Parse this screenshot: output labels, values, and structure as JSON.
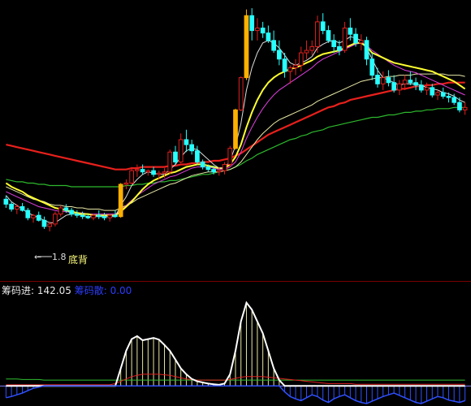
{
  "annotation": {
    "price_low": "1.8",
    "label": "底背"
  },
  "indicator": {
    "name1": "筹码进:",
    "value1": "142.05",
    "name2": "筹码散:",
    "value2": "0.00"
  },
  "colors": {
    "up": "#e0201e",
    "down": "#28ffff",
    "ma_red": "#e8201c",
    "ma_green": "#2db82d",
    "ma_yellow": "#ffff30",
    "ma_magenta": "#e040e0",
    "ma_white": "#dcdcdc",
    "ma_lightyellow": "#e8e8a8",
    "limit_up": "#ffb000"
  },
  "chart_data": {
    "type": "candlestick",
    "y_range_main": [
      1.4,
      3.6
    ],
    "x": [
      0,
      1,
      2,
      3,
      4,
      5,
      6,
      7,
      8,
      9,
      10,
      11,
      12,
      13,
      14,
      15,
      16,
      17,
      18,
      19,
      20,
      21,
      22,
      23,
      24,
      25,
      26,
      27,
      28,
      29,
      30,
      31,
      32,
      33,
      34,
      35,
      36,
      37,
      38,
      39,
      40,
      41,
      42,
      43,
      44,
      45,
      46,
      47,
      48,
      49,
      50,
      51,
      52,
      53,
      54,
      55,
      56,
      57,
      58,
      59,
      60,
      61,
      62,
      63,
      64,
      65,
      66,
      67,
      68,
      69,
      70,
      71,
      72,
      73,
      74,
      75,
      76,
      77,
      78,
      79,
      80,
      81,
      82,
      83,
      84
    ],
    "candles": [
      [
        2.02,
        2.05,
        1.95,
        1.98
      ],
      [
        1.98,
        2.0,
        1.92,
        1.94
      ],
      [
        1.94,
        1.98,
        1.9,
        1.96
      ],
      [
        1.96,
        1.99,
        1.92,
        1.93
      ],
      [
        1.93,
        1.95,
        1.85,
        1.87
      ],
      [
        1.87,
        1.9,
        1.83,
        1.89
      ],
      [
        1.89,
        1.92,
        1.84,
        1.85
      ],
      [
        1.85,
        1.88,
        1.78,
        1.8
      ],
      [
        1.8,
        1.84,
        1.76,
        1.82
      ],
      [
        1.82,
        1.92,
        1.8,
        1.9
      ],
      [
        1.9,
        1.97,
        1.88,
        1.95
      ],
      [
        1.95,
        1.98,
        1.91,
        1.93
      ],
      [
        1.93,
        1.95,
        1.88,
        1.9
      ],
      [
        1.9,
        1.93,
        1.87,
        1.89
      ],
      [
        1.89,
        1.92,
        1.86,
        1.88
      ],
      [
        1.88,
        1.9,
        1.86,
        1.87
      ],
      [
        1.87,
        1.9,
        1.85,
        1.89
      ],
      [
        1.89,
        1.93,
        1.86,
        1.88
      ],
      [
        1.88,
        1.91,
        1.85,
        1.87
      ],
      [
        1.87,
        1.9,
        1.84,
        1.89
      ],
      [
        1.89,
        1.93,
        1.87,
        1.88
      ],
      [
        1.88,
        2.15,
        1.87,
        2.14
      ],
      [
        2.14,
        2.18,
        2.1,
        2.15
      ],
      [
        2.15,
        2.28,
        2.14,
        2.25
      ],
      [
        2.25,
        2.3,
        2.2,
        2.26
      ],
      [
        2.26,
        2.3,
        2.22,
        2.24
      ],
      [
        2.24,
        2.26,
        2.21,
        2.25
      ],
      [
        2.25,
        2.28,
        2.2,
        2.22
      ],
      [
        2.22,
        2.25,
        2.18,
        2.23
      ],
      [
        2.23,
        2.27,
        2.19,
        2.24
      ],
      [
        2.24,
        2.42,
        2.22,
        2.4
      ],
      [
        2.4,
        2.45,
        2.3,
        2.32
      ],
      [
        2.32,
        2.55,
        2.31,
        2.5
      ],
      [
        2.5,
        2.58,
        2.4,
        2.46
      ],
      [
        2.46,
        2.5,
        2.38,
        2.41
      ],
      [
        2.41,
        2.45,
        2.3,
        2.32
      ],
      [
        2.32,
        2.34,
        2.26,
        2.28
      ],
      [
        2.28,
        2.3,
        2.24,
        2.26
      ],
      [
        2.26,
        2.29,
        2.22,
        2.24
      ],
      [
        2.24,
        2.28,
        2.21,
        2.25
      ],
      [
        2.25,
        2.32,
        2.22,
        2.3
      ],
      [
        2.3,
        2.45,
        2.28,
        2.43
      ],
      [
        2.43,
        2.75,
        2.42,
        2.74
      ],
      [
        2.74,
        3.01,
        2.73,
        3.0
      ],
      [
        3.0,
        3.55,
        2.98,
        3.5
      ],
      [
        3.5,
        3.56,
        3.3,
        3.38
      ],
      [
        3.38,
        3.48,
        3.3,
        3.4
      ],
      [
        3.4,
        3.45,
        3.32,
        3.36
      ],
      [
        3.36,
        3.42,
        3.28,
        3.3
      ],
      [
        3.3,
        3.38,
        3.2,
        3.22
      ],
      [
        3.22,
        3.3,
        3.1,
        3.15
      ],
      [
        3.15,
        3.2,
        3.0,
        3.05
      ],
      [
        3.05,
        3.1,
        2.95,
        3.08
      ],
      [
        3.08,
        3.15,
        3.02,
        3.1
      ],
      [
        3.1,
        3.25,
        3.05,
        3.2
      ],
      [
        3.2,
        3.3,
        3.15,
        3.22
      ],
      [
        3.22,
        3.3,
        3.18,
        3.25
      ],
      [
        3.25,
        3.5,
        3.2,
        3.45
      ],
      [
        3.45,
        3.52,
        3.35,
        3.38
      ],
      [
        3.38,
        3.42,
        3.28,
        3.3
      ],
      [
        3.3,
        3.35,
        3.2,
        3.25
      ],
      [
        3.25,
        3.3,
        3.18,
        3.22
      ],
      [
        3.22,
        3.45,
        3.2,
        3.4
      ],
      [
        3.4,
        3.48,
        3.3,
        3.35
      ],
      [
        3.35,
        3.4,
        3.25,
        3.28
      ],
      [
        3.28,
        3.35,
        3.22,
        3.3
      ],
      [
        3.3,
        3.33,
        3.1,
        3.15
      ],
      [
        3.15,
        3.2,
        2.98,
        3.02
      ],
      [
        3.02,
        3.08,
        2.92,
        2.95
      ],
      [
        2.95,
        3.05,
        2.9,
        3.0
      ],
      [
        3.0,
        3.06,
        2.93,
        2.96
      ],
      [
        2.96,
        3.02,
        2.88,
        2.9
      ],
      [
        2.9,
        2.98,
        2.86,
        2.95
      ],
      [
        2.95,
        3.02,
        2.9,
        2.98
      ],
      [
        2.98,
        3.05,
        2.94,
        2.96
      ],
      [
        2.96,
        3.0,
        2.9,
        2.94
      ],
      [
        2.94,
        2.98,
        2.88,
        2.9
      ],
      [
        2.9,
        2.96,
        2.86,
        2.92
      ],
      [
        2.92,
        2.95,
        2.84,
        2.86
      ],
      [
        2.86,
        2.9,
        2.82,
        2.88
      ],
      [
        2.88,
        2.92,
        2.83,
        2.85
      ],
      [
        2.85,
        2.88,
        2.8,
        2.84
      ],
      [
        2.84,
        2.87,
        2.78,
        2.8
      ],
      [
        2.8,
        2.84,
        2.72,
        2.74
      ],
      [
        2.74,
        2.8,
        2.7,
        2.76
      ]
    ],
    "limit_up_indices": [
      21,
      42,
      44
    ],
    "ma_red": [
      2.46,
      2.45,
      2.44,
      2.43,
      2.42,
      2.41,
      2.4,
      2.39,
      2.38,
      2.37,
      2.36,
      2.35,
      2.34,
      2.33,
      2.32,
      2.31,
      2.3,
      2.29,
      2.28,
      2.27,
      2.26,
      2.26,
      2.26,
      2.27,
      2.27,
      2.28,
      2.28,
      2.28,
      2.28,
      2.28,
      2.29,
      2.29,
      2.3,
      2.3,
      2.31,
      2.31,
      2.32,
      2.32,
      2.33,
      2.33,
      2.34,
      2.35,
      2.37,
      2.39,
      2.42,
      2.45,
      2.48,
      2.51,
      2.54,
      2.56,
      2.58,
      2.6,
      2.62,
      2.64,
      2.66,
      2.68,
      2.7,
      2.72,
      2.74,
      2.76,
      2.77,
      2.79,
      2.8,
      2.82,
      2.83,
      2.84,
      2.85,
      2.86,
      2.87,
      2.88,
      2.89,
      2.9,
      2.91,
      2.91,
      2.92,
      2.93,
      2.93,
      2.94,
      2.94,
      2.95,
      2.95,
      2.96,
      2.96,
      2.96,
      2.96
    ],
    "ma_green": [
      2.18,
      2.17,
      2.16,
      2.16,
      2.15,
      2.15,
      2.14,
      2.14,
      2.13,
      2.13,
      2.13,
      2.13,
      2.12,
      2.12,
      2.12,
      2.12,
      2.12,
      2.12,
      2.12,
      2.12,
      2.12,
      2.12,
      2.13,
      2.13,
      2.14,
      2.14,
      2.15,
      2.15,
      2.16,
      2.16,
      2.17,
      2.17,
      2.18,
      2.19,
      2.2,
      2.21,
      2.22,
      2.22,
      2.23,
      2.24,
      2.25,
      2.26,
      2.28,
      2.3,
      2.33,
      2.35,
      2.38,
      2.4,
      2.42,
      2.44,
      2.46,
      2.48,
      2.5,
      2.51,
      2.53,
      2.54,
      2.56,
      2.57,
      2.58,
      2.6,
      2.61,
      2.62,
      2.63,
      2.64,
      2.65,
      2.66,
      2.67,
      2.68,
      2.68,
      2.69,
      2.7,
      2.7,
      2.71,
      2.72,
      2.72,
      2.73,
      2.73,
      2.74,
      2.74,
      2.75,
      2.75,
      2.75,
      2.76,
      2.76,
      2.76
    ],
    "ma_yellow": [
      2.15,
      2.12,
      2.1,
      2.08,
      2.05,
      2.03,
      2.01,
      1.99,
      1.97,
      1.95,
      1.94,
      1.93,
      1.92,
      1.91,
      1.9,
      1.9,
      1.89,
      1.89,
      1.89,
      1.89,
      1.89,
      1.92,
      1.96,
      2.0,
      2.05,
      2.1,
      2.14,
      2.17,
      2.19,
      2.21,
      2.23,
      2.24,
      2.26,
      2.28,
      2.29,
      2.3,
      2.3,
      2.29,
      2.28,
      2.27,
      2.27,
      2.3,
      2.36,
      2.46,
      2.6,
      2.72,
      2.82,
      2.9,
      2.96,
      3.0,
      3.03,
      3.05,
      3.07,
      3.08,
      3.1,
      3.12,
      3.14,
      3.17,
      3.19,
      3.2,
      3.21,
      3.22,
      3.24,
      3.26,
      3.28,
      3.28,
      3.25,
      3.2,
      3.18,
      3.16,
      3.14,
      3.12,
      3.11,
      3.1,
      3.09,
      3.08,
      3.07,
      3.06,
      3.05,
      3.03,
      3.01,
      2.99,
      2.97,
      2.94,
      2.91
    ],
    "ma_magenta": [
      2.08,
      2.06,
      2.04,
      2.02,
      2.0,
      1.98,
      1.96,
      1.95,
      1.94,
      1.93,
      1.92,
      1.92,
      1.91,
      1.91,
      1.91,
      1.9,
      1.9,
      1.9,
      1.9,
      1.9,
      1.9,
      1.93,
      1.97,
      2.01,
      2.05,
      2.08,
      2.11,
      2.14,
      2.16,
      2.18,
      2.2,
      2.21,
      2.23,
      2.25,
      2.27,
      2.28,
      2.28,
      2.28,
      2.27,
      2.26,
      2.26,
      2.28,
      2.32,
      2.4,
      2.51,
      2.6,
      2.68,
      2.75,
      2.81,
      2.86,
      2.9,
      2.93,
      2.96,
      2.99,
      3.02,
      3.05,
      3.08,
      3.12,
      3.15,
      3.17,
      3.19,
      3.21,
      3.23,
      3.25,
      3.27,
      3.28,
      3.26,
      3.22,
      3.19,
      3.16,
      3.13,
      3.1,
      3.08,
      3.06,
      3.05,
      3.04,
      3.02,
      3.0,
      2.98,
      2.96,
      2.94,
      2.92,
      2.9,
      2.88,
      2.86
    ],
    "ma_white": [
      2.05,
      2.0,
      1.97,
      1.94,
      1.91,
      1.89,
      1.87,
      1.85,
      1.83,
      1.83,
      1.86,
      1.89,
      1.9,
      1.9,
      1.89,
      1.88,
      1.88,
      1.88,
      1.88,
      1.88,
      1.88,
      1.97,
      2.04,
      2.13,
      2.18,
      2.22,
      2.24,
      2.23,
      2.22,
      2.22,
      2.26,
      2.3,
      2.36,
      2.41,
      2.43,
      2.42,
      2.38,
      2.34,
      2.3,
      2.27,
      2.27,
      2.33,
      2.45,
      2.63,
      2.9,
      3.08,
      3.2,
      3.28,
      3.3,
      3.28,
      3.24,
      3.18,
      3.12,
      3.1,
      3.12,
      3.14,
      3.17,
      3.24,
      3.27,
      3.29,
      3.3,
      3.28,
      3.3,
      3.33,
      3.32,
      3.3,
      3.24,
      3.15,
      3.06,
      3.0,
      2.98,
      2.96,
      2.94,
      2.95,
      2.95,
      2.95,
      2.94,
      2.92,
      2.91,
      2.9,
      2.88,
      2.87,
      2.85,
      2.82,
      2.8
    ],
    "ma_lightyellow": [
      2.12,
      2.1,
      2.08,
      2.06,
      2.04,
      2.02,
      2.01,
      2.0,
      1.98,
      1.97,
      1.97,
      1.96,
      1.96,
      1.95,
      1.95,
      1.94,
      1.94,
      1.94,
      1.93,
      1.93,
      1.93,
      1.95,
      1.97,
      1.99,
      2.02,
      2.04,
      2.06,
      2.08,
      2.1,
      2.12,
      2.14,
      2.15,
      2.17,
      2.19,
      2.21,
      2.22,
      2.23,
      2.24,
      2.24,
      2.24,
      2.25,
      2.26,
      2.28,
      2.32,
      2.38,
      2.44,
      2.5,
      2.55,
      2.59,
      2.63,
      2.66,
      2.68,
      2.7,
      2.72,
      2.74,
      2.76,
      2.78,
      2.81,
      2.83,
      2.85,
      2.87,
      2.89,
      2.91,
      2.93,
      2.95,
      2.97,
      2.98,
      2.99,
      3.0,
      3.0,
      3.01,
      3.01,
      3.02,
      3.02,
      3.02,
      3.03,
      3.03,
      3.03,
      3.03,
      3.03,
      3.03,
      3.02,
      3.02,
      3.02,
      3.01
    ],
    "indicator": {
      "y_range": [
        -30,
        150
      ],
      "chip_in": [
        0,
        0,
        0,
        0,
        0,
        0,
        0,
        0,
        0,
        0,
        0,
        0,
        0,
        0,
        0,
        0,
        0,
        0,
        0,
        0,
        0,
        30,
        60,
        80,
        85,
        78,
        80,
        82,
        79,
        70,
        60,
        45,
        30,
        20,
        12,
        8,
        6,
        4,
        3,
        2,
        4,
        20,
        60,
        110,
        142,
        130,
        110,
        90,
        60,
        30,
        10,
        0,
        0,
        0,
        0,
        0,
        0,
        0,
        0,
        0,
        0,
        0,
        0,
        0,
        0,
        0,
        0,
        0,
        0,
        0,
        0,
        0,
        0,
        0,
        0,
        0,
        0,
        0,
        0,
        0,
        0,
        0,
        0,
        0,
        0
      ],
      "chip_out": [
        -20,
        -18,
        -15,
        -12,
        -8,
        -4,
        -2,
        0,
        0,
        0,
        0,
        0,
        0,
        0,
        0,
        0,
        0,
        0,
        0,
        0,
        0,
        0,
        0,
        0,
        0,
        0,
        0,
        0,
        0,
        0,
        0,
        0,
        0,
        0,
        0,
        0,
        0,
        0,
        0,
        0,
        0,
        0,
        0,
        0,
        0,
        0,
        0,
        0,
        0,
        0,
        0,
        -10,
        -18,
        -22,
        -25,
        -20,
        -15,
        -18,
        -24,
        -28,
        -22,
        -18,
        -15,
        -20,
        -25,
        -28,
        -30,
        -26,
        -22,
        -18,
        -15,
        -12,
        -16,
        -20,
        -24,
        -28,
        -30,
        -26,
        -22,
        -18,
        -20,
        -24,
        -26,
        -28,
        -25
      ],
      "line_red": [
        2,
        2,
        2,
        2,
        2,
        2,
        2,
        2,
        2,
        2,
        2,
        2,
        2,
        2,
        2,
        2,
        2,
        2,
        2,
        2,
        4,
        8,
        12,
        16,
        18,
        20,
        20,
        20,
        20,
        19,
        18,
        16,
        14,
        12,
        11,
        10,
        10,
        10,
        10,
        10,
        10,
        11,
        13,
        15,
        16,
        16,
        16,
        16,
        15,
        14,
        13,
        12,
        11,
        10,
        9,
        8,
        7,
        6,
        5,
        4,
        4,
        4,
        4,
        4,
        3,
        3,
        3,
        3,
        3,
        3,
        3,
        3,
        3,
        3,
        3,
        3,
        3,
        3,
        3,
        3,
        3,
        3,
        3,
        3,
        3
      ],
      "line_green": [
        12,
        12,
        12,
        11,
        11,
        11,
        11,
        10,
        10,
        10,
        10,
        10,
        10,
        10,
        10,
        10,
        10,
        10,
        10,
        10,
        10,
        10,
        10,
        10,
        10,
        10,
        10,
        10,
        10,
        10,
        10,
        10,
        10,
        10,
        10,
        10,
        10,
        10,
        10,
        10,
        10,
        10,
        10,
        10,
        10,
        10,
        10,
        10,
        10,
        10,
        10,
        10,
        10,
        10,
        10,
        10,
        10,
        10,
        10,
        10,
        10,
        10,
        10,
        10,
        10,
        10,
        10,
        10,
        10,
        10,
        10,
        10,
        10,
        10,
        10,
        10,
        10,
        10,
        10,
        10,
        10,
        10,
        10,
        10,
        10
      ]
    }
  }
}
